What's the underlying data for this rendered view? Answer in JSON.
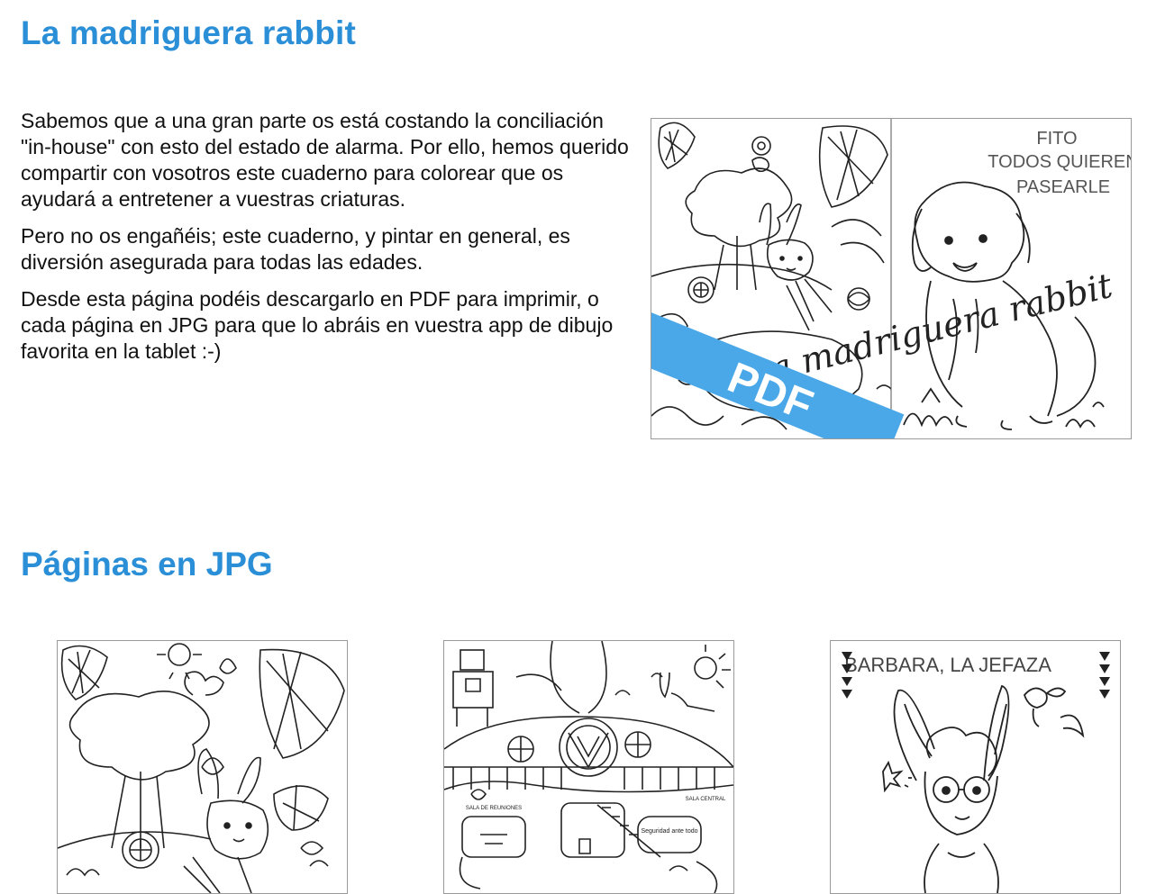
{
  "header": {
    "title": "La madriguera rabbit"
  },
  "intro": {
    "paragraphs": [
      "Sabemos que a una gran parte os está costando la conciliación \"in-house\" con esto del estado de alarma. Por ello, hemos querido compartir con vosotros este cuaderno para colorear que os ayudará a entretener a vuestras criaturas.",
      "Pero no os engañéis; este cuaderno, y pintar en general, es diversión asegurada para todas las edades.",
      "Desde esta página podéis descargarlo en PDF para imprimir, o cada página en JPG para que lo abráis en vuestra app de dibujo favorita en la tablet :-)"
    ]
  },
  "pdf_download": {
    "banner": "PDF",
    "cover_title": "La madriguera rabbit",
    "back_caption_line1": "FITO",
    "back_caption_line2": "TODOS QUIEREN",
    "back_caption_line3": "PASEARLE",
    "banner_color": "#4aa8e8"
  },
  "jpg_section": {
    "title": "Páginas en JPG",
    "pages": [
      {
        "caption": ""
      },
      {
        "caption": "",
        "labels": [
          "SALA DE REUNIONES",
          "SALA CENTRAL",
          "Seguridad ante todo"
        ]
      },
      {
        "caption": "BARBARA, LA JEFAZA"
      }
    ]
  },
  "colors": {
    "accent": "#2b8fd8",
    "text": "#111111",
    "border": "#9a9a9a"
  }
}
